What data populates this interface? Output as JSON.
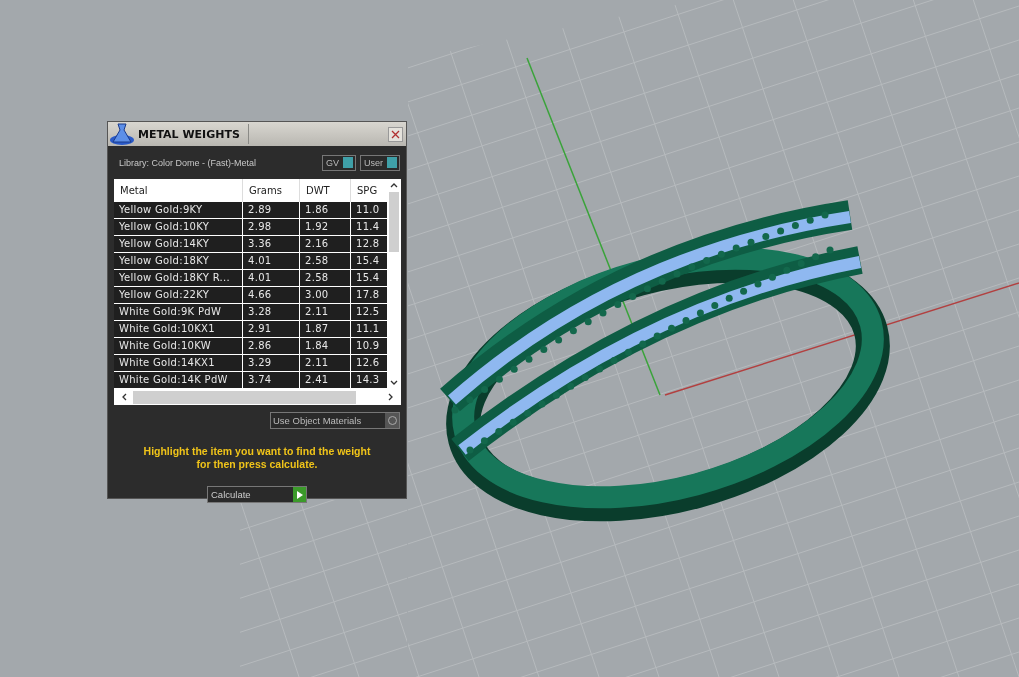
{
  "dialog": {
    "title": "METAL WEIGHTS",
    "library": "Library: Color Dome - (Fast)-Metal",
    "toggles": [
      {
        "label": "GV",
        "on": true
      },
      {
        "label": "User",
        "on": true
      }
    ],
    "table": {
      "columns": [
        "Metal",
        "Grams",
        "DWT",
        "SPG"
      ],
      "rows": [
        [
          "Yellow Gold:9KY",
          "2.89",
          "1.86",
          "11.0"
        ],
        [
          "Yellow Gold:10KY",
          "2.98",
          "1.92",
          "11.4"
        ],
        [
          "Yellow Gold:14KY",
          "3.36",
          "2.16",
          "12.8"
        ],
        [
          "Yellow Gold:18KY",
          "4.01",
          "2.58",
          "15.4"
        ],
        [
          "Yellow Gold:18KY R...",
          "4.01",
          "2.58",
          "15.4"
        ],
        [
          "Yellow Gold:22KY",
          "4.66",
          "3.00",
          "17.8"
        ],
        [
          "White Gold:9K PdW",
          "3.28",
          "2.11",
          "12.5"
        ],
        [
          "White Gold:10KX1",
          "2.91",
          "1.87",
          "11.1"
        ],
        [
          "White Gold:10KW",
          "2.86",
          "1.84",
          "10.9"
        ],
        [
          "White Gold:14KX1",
          "3.29",
          "2.11",
          "12.6"
        ],
        [
          "White Gold:14K PdW",
          "3.74",
          "2.41",
          "14.3"
        ]
      ]
    },
    "option": {
      "label": "Use Object Materials",
      "selected": false
    },
    "hint": "Highlight the item you want to find the weight for then press calculate.",
    "button": "Calculate"
  }
}
